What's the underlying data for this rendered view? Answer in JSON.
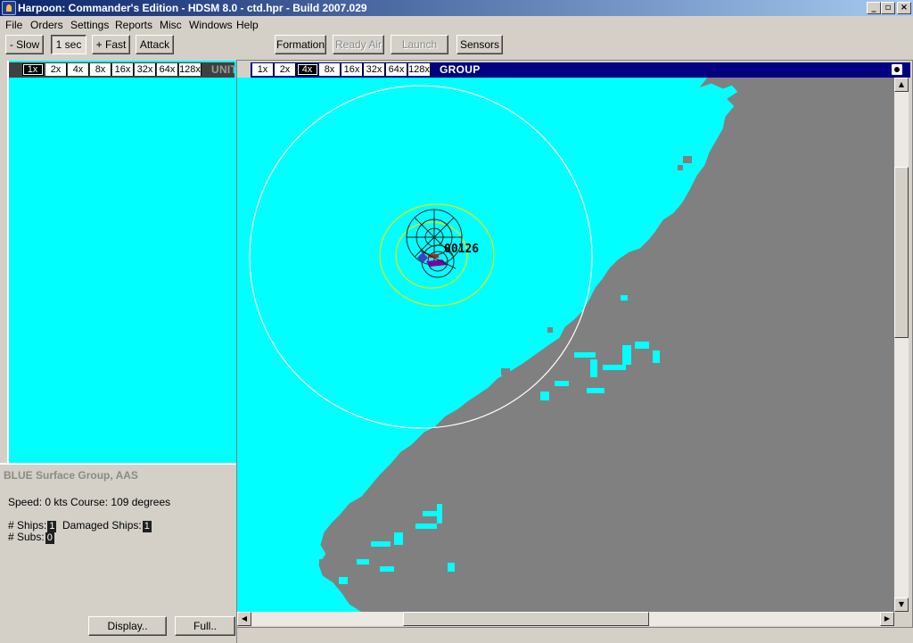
{
  "window": {
    "title": "Harpoon: Commander's Edition - HDSM 8.0 - ctd.hpr - Build 2007.029"
  },
  "menu": [
    "File",
    "Orders",
    "Settings",
    "Reports",
    "Misc",
    "Windows",
    "Help"
  ],
  "toolbar": {
    "slow": "- Slow",
    "interval": "1 sec",
    "fast": "+ Fast",
    "attack": "Attack",
    "formation": "Formation",
    "ready_air": "Ready Air",
    "launch": "Launch",
    "sensors": "Sensors"
  },
  "zoom_levels": [
    "1x",
    "2x",
    "4x",
    "8x",
    "16x",
    "32x",
    "64x",
    "128x"
  ],
  "unit_window": {
    "label": "UNIT",
    "active_zoom": "1x"
  },
  "map_window": {
    "label": "GROUP",
    "active_zoom": "4x",
    "group_id": "00126"
  },
  "group_panel": {
    "title": "BLUE Surface Group, AAS",
    "speed_course": "Speed: 0 kts   Course: 109 degrees",
    "ships_label": "# Ships:",
    "ships_value": "1",
    "damaged_label": "Damaged Ships:",
    "damaged_value": "1",
    "subs_label": "# Subs:",
    "subs_value": "0",
    "display_button": "Display..",
    "full_button": "Full.."
  },
  "colors": {
    "sea": "#00ffff",
    "land": "#808080",
    "range_ring": "#ffffff",
    "sensor_ring": "#e8e800",
    "title_bar": "#0a246a"
  }
}
